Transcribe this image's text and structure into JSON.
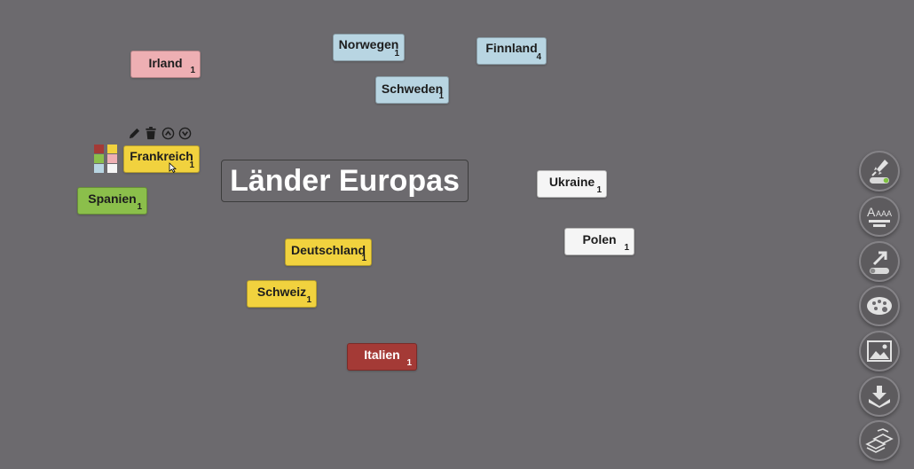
{
  "map": {
    "title": "Länder Europas",
    "nodes": [
      {
        "id": "irland",
        "label": "Irland",
        "count": "1"
      },
      {
        "id": "norwegen",
        "label": "Norwegen",
        "count": "1"
      },
      {
        "id": "finnland",
        "label": "Finnland",
        "count": "4"
      },
      {
        "id": "schweden",
        "label": "Schweden",
        "count": "1"
      },
      {
        "id": "frankreich",
        "label": "Frankreich",
        "count": "1"
      },
      {
        "id": "spanien",
        "label": "Spanien",
        "count": "1"
      },
      {
        "id": "ukraine",
        "label": "Ukraine",
        "count": "1"
      },
      {
        "id": "polen",
        "label": "Polen",
        "count": "1"
      },
      {
        "id": "deutschland",
        "label": "Deutschland",
        "count": "1"
      },
      {
        "id": "schweiz",
        "label": "Schweiz",
        "count": "1"
      },
      {
        "id": "italien",
        "label": "Italien",
        "count": "1"
      }
    ]
  },
  "colors": {
    "background": "#6c6a6e",
    "blue": "#b8d5e2",
    "pink": "#eeafb3",
    "yellow": "#f1d23e",
    "green": "#8bbf4b",
    "white": "#f5f5f5",
    "red": "#a43a36"
  },
  "palette_swatches": [
    "#a43a36",
    "#f1d23e",
    "#8bbf4b",
    "#eeafb3",
    "#b8d5e2",
    "#f5f5f5"
  ],
  "node_toolbar_icons": [
    "pencil-icon",
    "trash-icon",
    "move-up-icon",
    "move-down-icon"
  ],
  "side_toolbar_icons": [
    "rocket-toggle-icon",
    "font-size-icon",
    "share-export-icon",
    "palette-icon",
    "image-icon",
    "download-icon",
    "layers-icon"
  ]
}
